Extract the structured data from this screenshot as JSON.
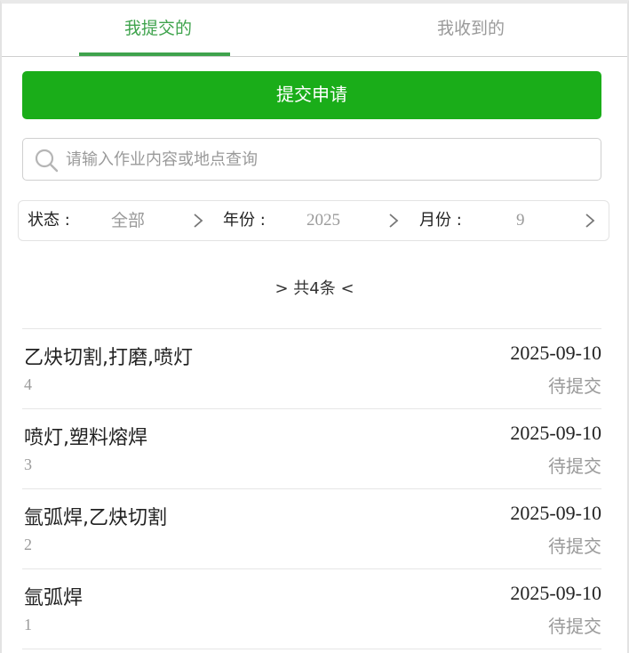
{
  "tabs": [
    {
      "label": "我提交的",
      "active": true
    },
    {
      "label": "我收到的",
      "active": false
    }
  ],
  "colors": {
    "accent": "#3fa34d",
    "primary_button": "#1aad19",
    "muted": "#9a9a9a"
  },
  "submit_button": {
    "label": "提交申请"
  },
  "search": {
    "placeholder": "请输入作业内容或地点查询",
    "value": "",
    "icon": "search-icon"
  },
  "filters": {
    "status": {
      "label": "状态 :",
      "value": "全部",
      "icon": "chevron-right-icon"
    },
    "year": {
      "label": "年份 :",
      "value": "2025",
      "icon": "chevron-right-icon"
    },
    "month": {
      "label": "月份 :",
      "value": "9",
      "icon": "chevron-right-icon"
    }
  },
  "count_text": "> 共4条 <",
  "records": [
    {
      "title": "乙炔切割,打磨,喷灯",
      "num": "4",
      "date": "2025-09-10",
      "status": "待提交"
    },
    {
      "title": "喷灯,塑料熔焊",
      "num": "3",
      "date": "2025-09-10",
      "status": "待提交"
    },
    {
      "title": "氩弧焊,乙炔切割",
      "num": "2",
      "date": "2025-09-10",
      "status": "待提交"
    },
    {
      "title": "氩弧焊",
      "num": "1",
      "date": "2025-09-10",
      "status": "待提交"
    }
  ]
}
